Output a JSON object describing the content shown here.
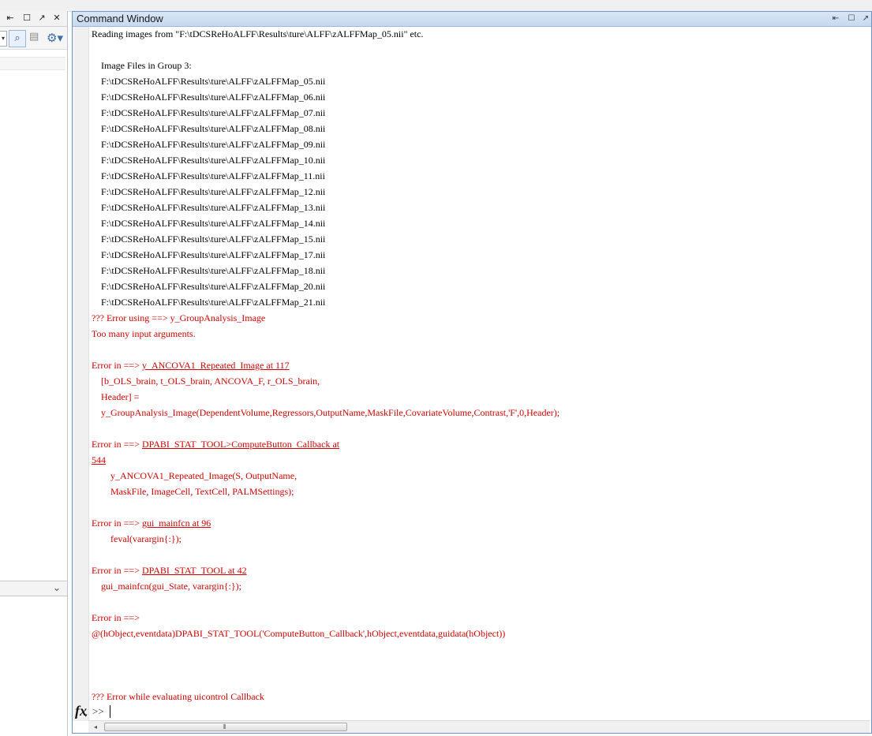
{
  "left_panel": {
    "titlebar": {
      "undock_icon": "⇤",
      "maximize_icon": "☐",
      "popout_icon": "↗",
      "close_icon": "✕"
    },
    "toolbar": {
      "dropdown_icon": "▾",
      "search_icon": "⌕",
      "folder_icon": "▤",
      "gear_icon": "⚙▾"
    },
    "detail_chevron": "⌄"
  },
  "command_window": {
    "title": "Command Window",
    "controls": {
      "undock_icon": "⇤",
      "maximize_icon": "☐",
      "popout_icon": "↗"
    },
    "lines": [
      {
        "text": "Reading images from \"F:\\tDCSReHoALFF\\Results\\ture\\ALFF\\zALFFMap_05.nii\" etc.",
        "style": "normal"
      },
      {
        "text": "",
        "style": "normal"
      },
      {
        "text": "    Image Files in Group 3:",
        "style": "normal"
      },
      {
        "text": "    F:\\tDCSReHoALFF\\Results\\ture\\ALFF\\zALFFMap_05.nii",
        "style": "normal"
      },
      {
        "text": "    F:\\tDCSReHoALFF\\Results\\ture\\ALFF\\zALFFMap_06.nii",
        "style": "normal"
      },
      {
        "text": "    F:\\tDCSReHoALFF\\Results\\ture\\ALFF\\zALFFMap_07.nii",
        "style": "normal"
      },
      {
        "text": "    F:\\tDCSReHoALFF\\Results\\ture\\ALFF\\zALFFMap_08.nii",
        "style": "normal"
      },
      {
        "text": "    F:\\tDCSReHoALFF\\Results\\ture\\ALFF\\zALFFMap_09.nii",
        "style": "normal"
      },
      {
        "text": "    F:\\tDCSReHoALFF\\Results\\ture\\ALFF\\zALFFMap_10.nii",
        "style": "normal"
      },
      {
        "text": "    F:\\tDCSReHoALFF\\Results\\ture\\ALFF\\zALFFMap_11.nii",
        "style": "normal"
      },
      {
        "text": "    F:\\tDCSReHoALFF\\Results\\ture\\ALFF\\zALFFMap_12.nii",
        "style": "normal"
      },
      {
        "text": "    F:\\tDCSReHoALFF\\Results\\ture\\ALFF\\zALFFMap_13.nii",
        "style": "normal"
      },
      {
        "text": "    F:\\tDCSReHoALFF\\Results\\ture\\ALFF\\zALFFMap_14.nii",
        "style": "normal"
      },
      {
        "text": "    F:\\tDCSReHoALFF\\Results\\ture\\ALFF\\zALFFMap_15.nii",
        "style": "normal"
      },
      {
        "text": "    F:\\tDCSReHoALFF\\Results\\ture\\ALFF\\zALFFMap_17.nii",
        "style": "normal"
      },
      {
        "text": "    F:\\tDCSReHoALFF\\Results\\ture\\ALFF\\zALFFMap_18.nii",
        "style": "normal"
      },
      {
        "text": "    F:\\tDCSReHoALFF\\Results\\ture\\ALFF\\zALFFMap_20.nii",
        "style": "normal"
      },
      {
        "text": "    F:\\tDCSReHoALFF\\Results\\ture\\ALFF\\zALFFMap_21.nii",
        "style": "normal"
      },
      {
        "text": "??? Error using ==> y_GroupAnalysis_Image",
        "style": "err"
      },
      {
        "text": "Too many input arguments.",
        "style": "err"
      },
      {
        "text": "",
        "style": "normal"
      },
      {
        "text": "Error in ==> ",
        "link": "y_ANCOVA1_Repeated_Image at 117",
        "style": "err"
      },
      {
        "text": "    [b_OLS_brain, t_OLS_brain, ANCOVA_F, r_OLS_brain,",
        "style": "err"
      },
      {
        "text": "    Header] =",
        "style": "err"
      },
      {
        "text": "    y_GroupAnalysis_Image(DependentVolume,Regressors,OutputName,MaskFile,CovariateVolume,Contrast,'F',0,Header);",
        "style": "err"
      },
      {
        "text": "",
        "style": "normal"
      },
      {
        "text": "Error in ==> ",
        "link": "DPABI_STAT_TOOL>ComputeButton_Callback at",
        "style": "err"
      },
      {
        "text": "",
        "link": "544",
        "style": "err"
      },
      {
        "text": "        y_ANCOVA1_Repeated_Image(S, OutputName,",
        "style": "err"
      },
      {
        "text": "        MaskFile, ImageCell, TextCell, PALMSettings);",
        "style": "err"
      },
      {
        "text": "",
        "style": "normal"
      },
      {
        "text": "Error in ==> ",
        "link": "gui_mainfcn at 96",
        "style": "err"
      },
      {
        "text": "        feval(varargin{:});",
        "style": "err"
      },
      {
        "text": "",
        "style": "normal"
      },
      {
        "text": "Error in ==> ",
        "link": "DPABI_STAT_TOOL at 42",
        "style": "err"
      },
      {
        "text": "    gui_mainfcn(gui_State, varargin{:});",
        "style": "err"
      },
      {
        "text": "",
        "style": "normal"
      },
      {
        "text": "Error in ==>",
        "style": "err"
      },
      {
        "text": "@(hObject,eventdata)DPABI_STAT_TOOL('ComputeButton_Callback',hObject,eventdata,guidata(hObject))",
        "style": "err"
      },
      {
        "text": "",
        "style": "normal"
      },
      {
        "text": "",
        "style": "normal"
      },
      {
        "text": "",
        "style": "normal"
      },
      {
        "text": "??? Error while evaluating uicontrol Callback",
        "style": "err"
      }
    ],
    "prompt": {
      "fx_icon": "fx",
      "fx_sub": "▾",
      "symbol": ">>"
    },
    "hscroll": {
      "left_arrow": "◂",
      "grip": "⦀"
    }
  }
}
